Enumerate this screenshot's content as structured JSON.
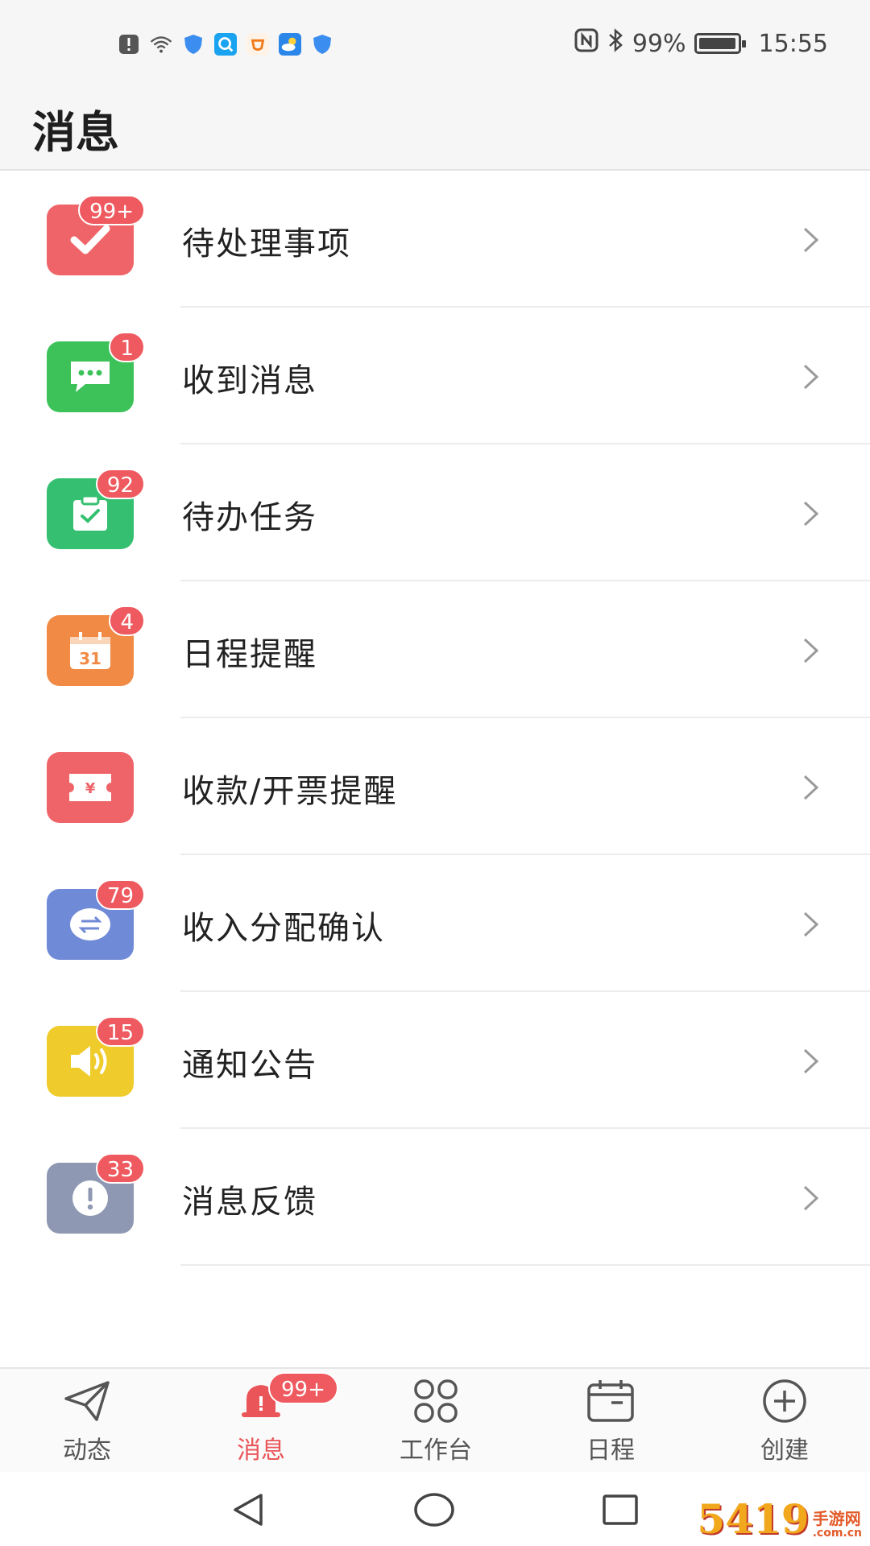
{
  "status_bar": {
    "battery_percent": "99%",
    "battery_level": 0.99,
    "time": "15:55",
    "left_icons": [
      "alert-icon",
      "wifi-icon",
      "shield-icon",
      "search-app-icon",
      "orange-app-icon",
      "weather-app-icon",
      "shield-icon"
    ],
    "right_icons": [
      "nfc-icon",
      "bluetooth-icon",
      "battery-icon"
    ]
  },
  "header": {
    "title": "消息"
  },
  "messages": [
    {
      "label": "待处理事项",
      "badge": "99+",
      "icon": "checkmark-icon",
      "color": "#ef6469"
    },
    {
      "label": "收到消息",
      "badge": "1",
      "icon": "chat-bubble-icon",
      "color": "#3dc25a"
    },
    {
      "label": "待办任务",
      "badge": "92",
      "icon": "clipboard-check-icon",
      "color": "#35c071"
    },
    {
      "label": "日程提醒",
      "badge": "4",
      "icon": "calendar-31-icon",
      "color": "#f08a45"
    },
    {
      "label": "收款/开票提醒",
      "badge": "",
      "icon": "yen-ticket-icon",
      "color": "#ef6469"
    },
    {
      "label": "收入分配确认",
      "badge": "79",
      "icon": "exchange-icon",
      "color": "#6f8ad6"
    },
    {
      "label": "通知公告",
      "badge": "15",
      "icon": "speaker-icon",
      "color": "#efcc2b"
    },
    {
      "label": "消息反馈",
      "badge": "33",
      "icon": "exclamation-icon",
      "color": "#8f98b2"
    }
  ],
  "bottom_nav": [
    {
      "label": "动态",
      "icon": "paper-plane-icon",
      "active": false,
      "badge": ""
    },
    {
      "label": "消息",
      "icon": "bell-icon",
      "active": true,
      "badge": "99+"
    },
    {
      "label": "工作台",
      "icon": "grid-icon",
      "active": false,
      "badge": ""
    },
    {
      "label": "日程",
      "icon": "calendar-icon",
      "active": false,
      "badge": ""
    },
    {
      "label": "创建",
      "icon": "plus-circle-icon",
      "active": false,
      "badge": ""
    }
  ],
  "system_nav": [
    "back-icon",
    "home-icon",
    "recents-icon"
  ],
  "watermark": {
    "main": "5419",
    "side_top": "手游网",
    "side_bottom": ".com.cn"
  },
  "colors": {
    "accent": "#e95559",
    "badge": "#ee5a5f"
  }
}
